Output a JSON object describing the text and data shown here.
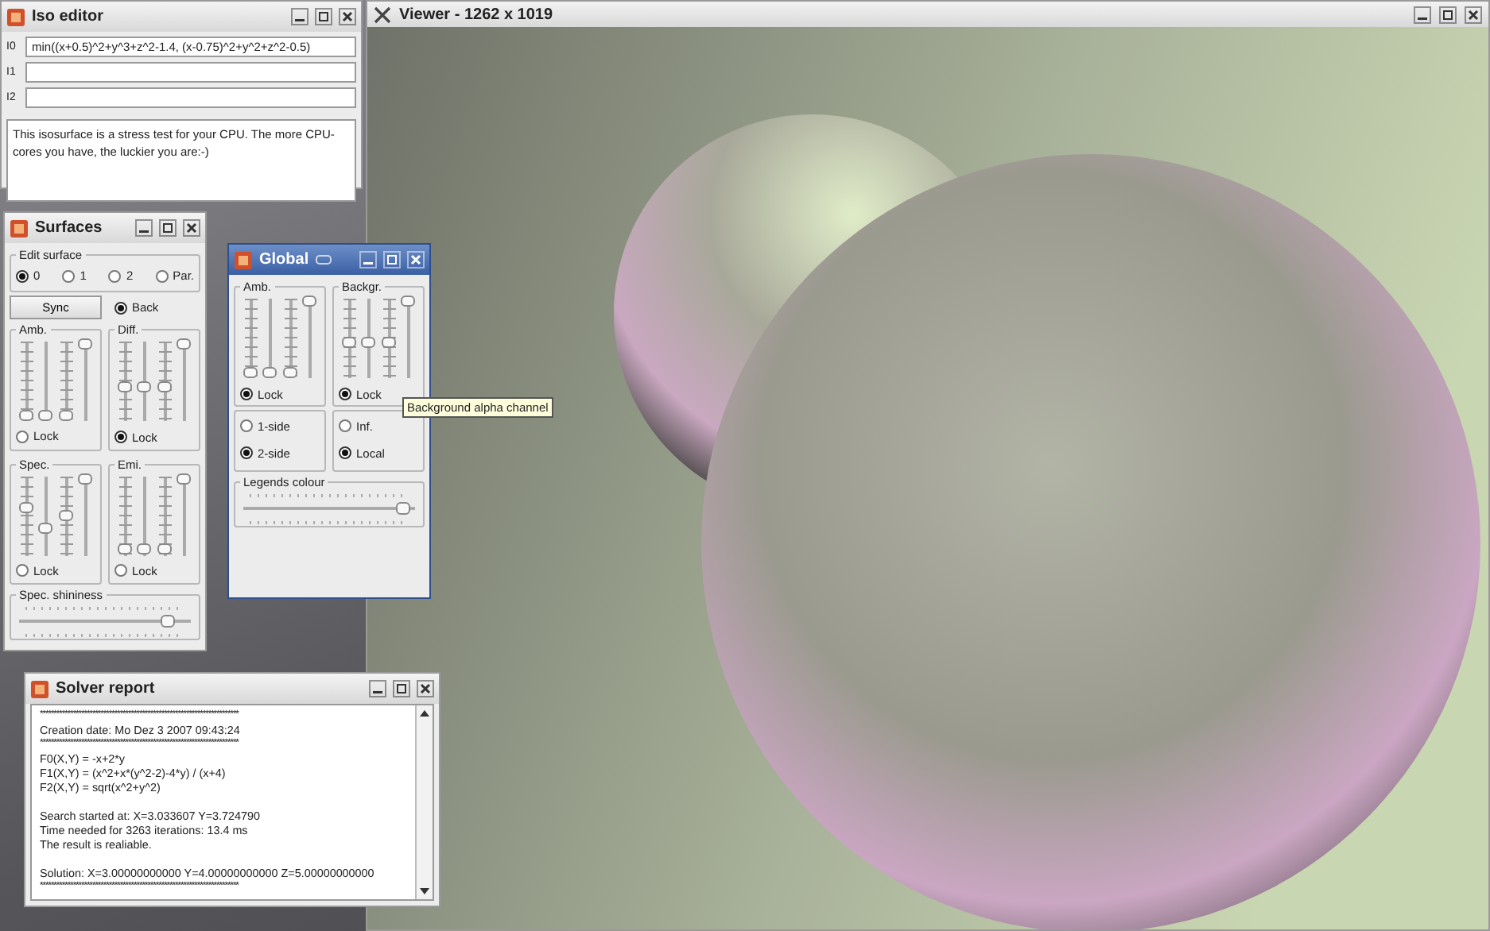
{
  "viewer": {
    "title": "Viewer - 1262 x 1019"
  },
  "iso_editor": {
    "title": "Iso editor",
    "fields": [
      {
        "label": "I0",
        "value": "min((x+0.5)^2+y^3+z^2-1.4,  (x-0.75)^2+y^2+z^2-0.5)"
      },
      {
        "label": "I1"
      },
      {
        "label": "I2"
      }
    ],
    "note": "This isosurface is a stress test for your CPU. The more CPU-cores you have, the luckier you are:-)"
  },
  "surfaces": {
    "title": "Surfaces",
    "edit_surface": {
      "legend": "Edit surface",
      "options": [
        {
          "label": "0",
          "selected": true
        },
        {
          "label": "1",
          "selected": false
        },
        {
          "label": "2",
          "selected": false
        },
        {
          "label": "Par.",
          "selected": false
        }
      ]
    },
    "sync_button": "Sync",
    "back": {
      "label": "Back",
      "checked": true
    },
    "groups": [
      {
        "legend": "Amb.",
        "sliders": [
          {
            "level": 0.05
          },
          {
            "level": 0.05
          },
          {
            "level": 0.05
          },
          {
            "level": 1
          }
        ],
        "lock": {
          "label": "Lock",
          "checked": false
        }
      },
      {
        "legend": "Diff.",
        "sliders": [
          {
            "level": 0.42
          },
          {
            "level": 0.42
          },
          {
            "level": 0.42
          },
          {
            "level": 1
          }
        ],
        "lock": {
          "label": "Lock",
          "checked": true
        }
      },
      {
        "legend": "Spec.",
        "sliders": [
          {
            "level": 0.6
          },
          {
            "level": 0.32
          },
          {
            "level": 0.5
          },
          {
            "level": 1
          }
        ],
        "lock": {
          "label": "Lock",
          "checked": false
        }
      },
      {
        "legend": "Emi.",
        "sliders": [
          {
            "level": 0.05
          },
          {
            "level": 0.05
          },
          {
            "level": 0.05
          },
          {
            "level": 1
          }
        ],
        "lock": {
          "label": "Lock",
          "checked": false
        }
      }
    ],
    "shininess": {
      "legend": "Spec. shininess",
      "level": 0.88
    }
  },
  "global": {
    "title": "Global",
    "groups": [
      {
        "legend": "Amb.",
        "sliders": [
          {
            "level": 0.05
          },
          {
            "level": 0.05
          },
          {
            "level": 0.05
          },
          {
            "level": 1
          }
        ],
        "lock": {
          "label": "Lock",
          "checked": true
        }
      },
      {
        "legend": "Backgr.",
        "sliders": [
          {
            "level": 0.45
          },
          {
            "level": 0.45
          },
          {
            "level": 0.45
          },
          {
            "level": 1
          }
        ],
        "lock": {
          "label": "Lock",
          "checked": true
        }
      }
    ],
    "sides": [
      {
        "label": "1-side",
        "selected": false
      },
      {
        "label": "2-side",
        "selected": true
      }
    ],
    "lights": [
      {
        "label": "Inf.",
        "selected": false
      },
      {
        "label": "Local",
        "selected": true
      }
    ],
    "legends_colour": {
      "legend": "Legends colour",
      "level": 0.95
    },
    "tooltip": "Background alpha channel"
  },
  "solver_report": {
    "title": "Solver report",
    "paragraphs": [
      [
        {
          "kind": "rule",
          "text": "************************************************************************"
        },
        {
          "kind": "text",
          "text": "Creation date:  Mo Dez 3 2007  09:43:24"
        },
        {
          "kind": "rule",
          "text": "************************************************************************"
        },
        {
          "kind": "text",
          "text": "F0(X,Y) = -x+2*y"
        },
        {
          "kind": "text",
          "text": "F1(X,Y) = (x^2+x*(y^2-2)-4*y) / (x+4)"
        },
        {
          "kind": "text",
          "text": "F2(X,Y) = sqrt(x^2+y^2)"
        }
      ],
      [
        {
          "kind": "text",
          "text": "Search started at:  X=3.033607  Y=3.724790"
        },
        {
          "kind": "text",
          "text": "Time needed for 3263 iterations: 13.4 ms"
        },
        {
          "kind": "text",
          "text": "The result is realiable."
        }
      ],
      [
        {
          "kind": "text",
          "text": "Solution:  X=3.00000000000  Y=4.00000000000  Z=5.00000000000"
        },
        {
          "kind": "rule",
          "text": "************************************************************************"
        }
      ]
    ]
  }
}
